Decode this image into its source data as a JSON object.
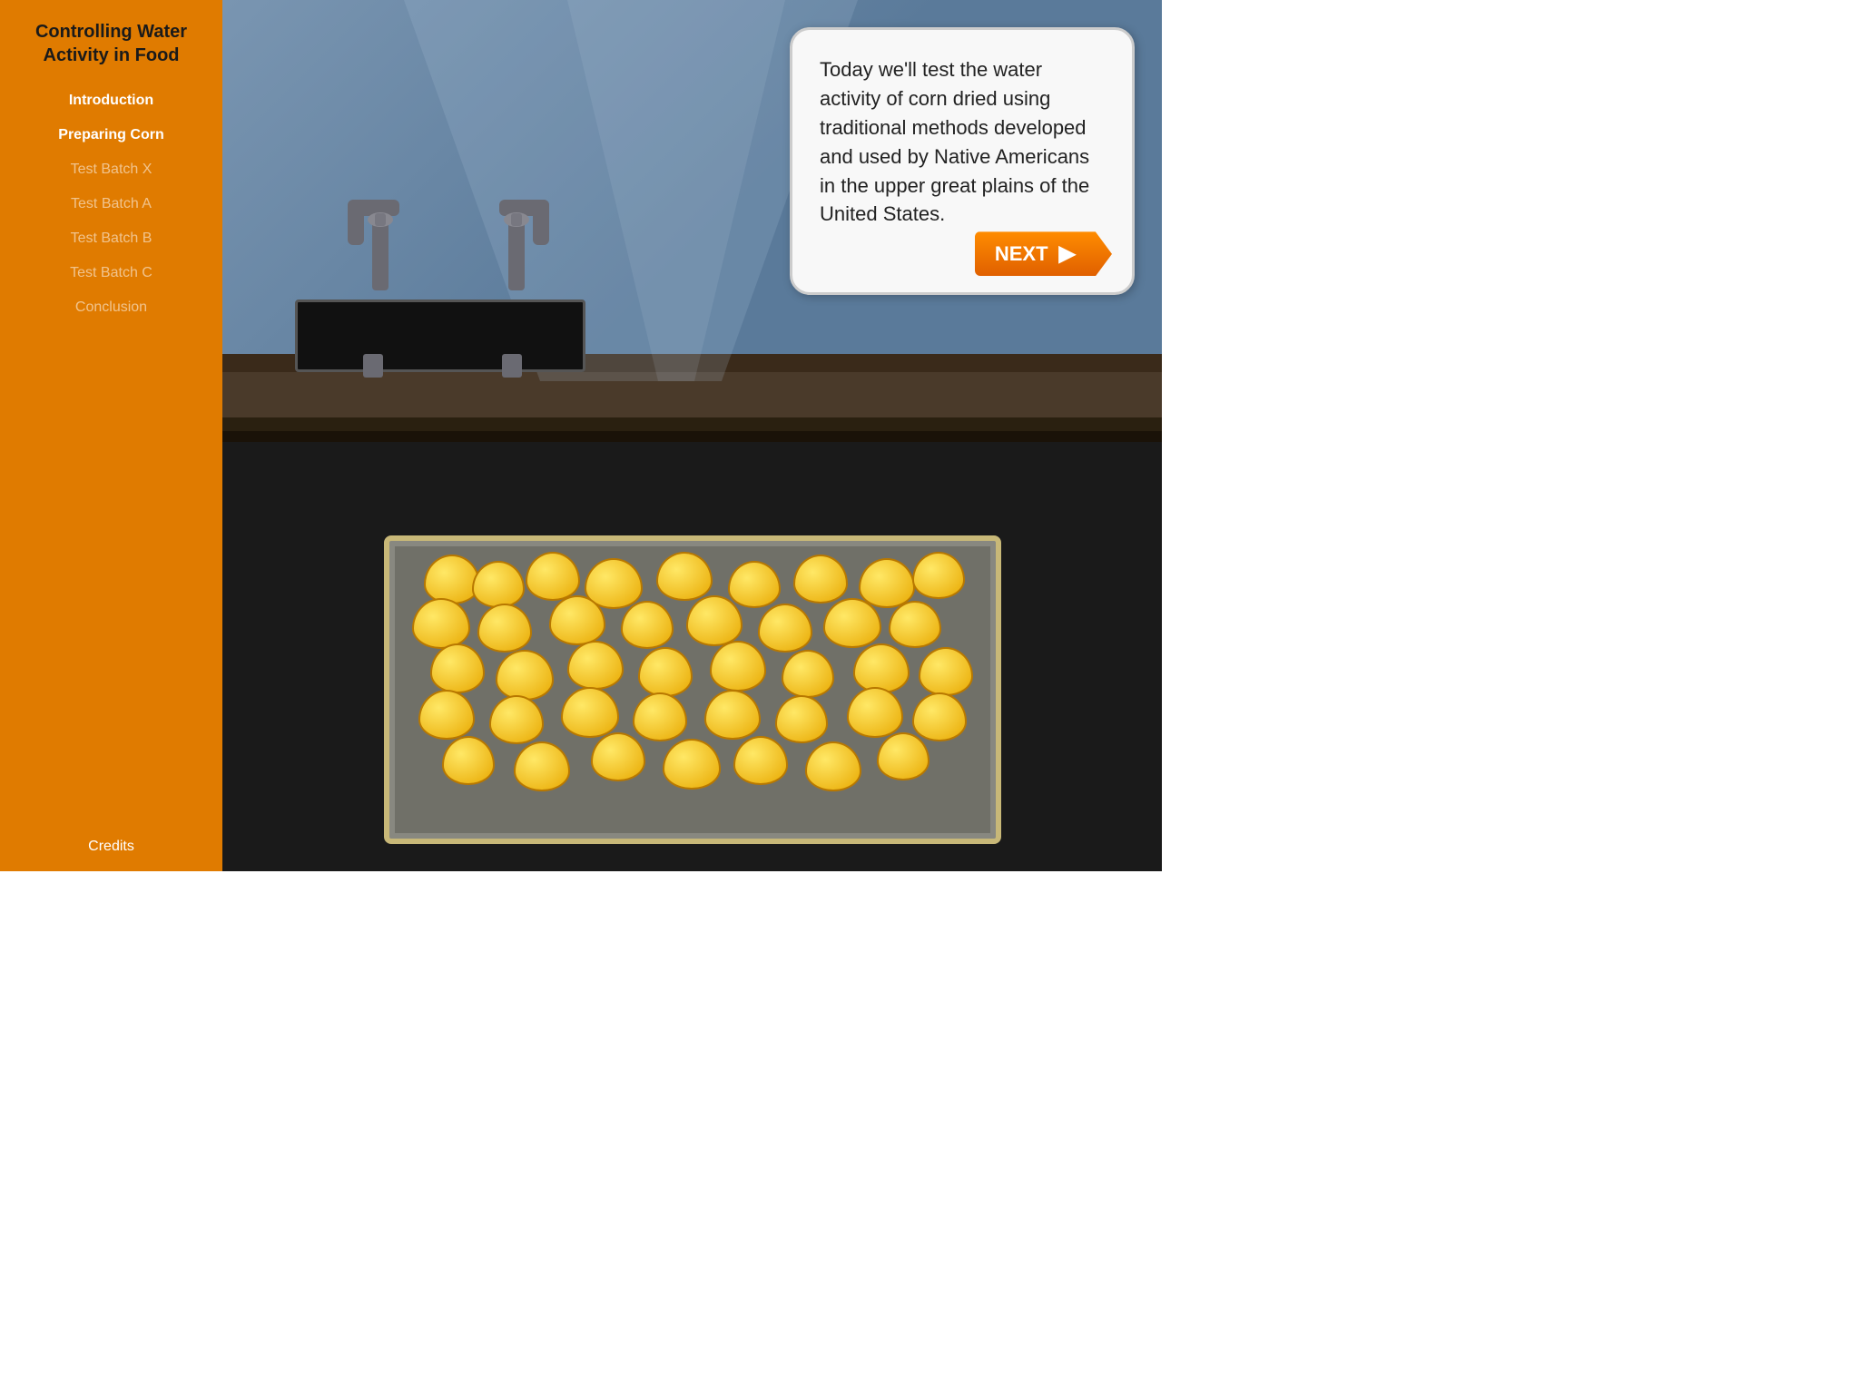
{
  "sidebar": {
    "title": "Controlling Water Activity in Food",
    "nav": [
      {
        "id": "introduction",
        "label": "Introduction",
        "state": "active"
      },
      {
        "id": "preparing-corn",
        "label": "Preparing Corn",
        "state": "active"
      },
      {
        "id": "test-batch-x",
        "label": "Test Batch X",
        "state": "inactive"
      },
      {
        "id": "test-batch-a",
        "label": "Test Batch A",
        "state": "inactive"
      },
      {
        "id": "test-batch-b",
        "label": "Test Batch B",
        "state": "inactive"
      },
      {
        "id": "test-batch-c",
        "label": "Test Batch C",
        "state": "inactive"
      },
      {
        "id": "conclusion",
        "label": "Conclusion",
        "state": "inactive"
      }
    ],
    "credits_label": "Credits"
  },
  "main": {
    "dialogue": "Today we'll test the water activity of corn dried using traditional methods developed and used by Native Americans in the upper great plains of the United States.",
    "next_label": "NEXT"
  },
  "colors": {
    "sidebar_bg": "#e07b00",
    "active_nav": "#ffffff",
    "inactive_nav": "rgba(255,255,255,0.55)",
    "next_btn": "#e06000"
  }
}
